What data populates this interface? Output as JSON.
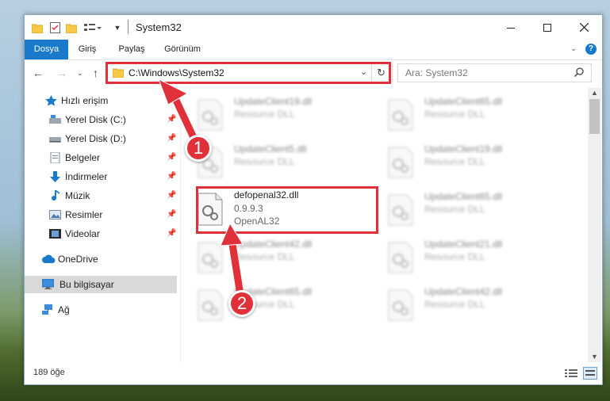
{
  "window": {
    "title": "System32"
  },
  "ribbon": {
    "tabs": [
      "Dosya",
      "Giriş",
      "Paylaş",
      "Görünüm"
    ]
  },
  "address": {
    "path": "C:\\Windows\\System32"
  },
  "search": {
    "placeholder": "Ara: System32"
  },
  "sidebar": {
    "items": [
      {
        "label": "Hızlı erişim"
      },
      {
        "label": "Yerel Disk (C:)"
      },
      {
        "label": "Yerel Disk (D:)"
      },
      {
        "label": "Belgeler"
      },
      {
        "label": "İndirmeler"
      },
      {
        "label": "Müzik"
      },
      {
        "label": "Resimler"
      },
      {
        "label": "Videolar"
      },
      {
        "label": "OneDrive"
      },
      {
        "label": "Bu bilgisayar"
      },
      {
        "label": "Ağ"
      }
    ]
  },
  "files": {
    "left": [
      {
        "name": "UpdateClient19.dll",
        "desc": "Resource DLL"
      },
      {
        "name": "UpdateClient5.dll",
        "desc": "Resource DLL"
      },
      {
        "name": "defopenal32.dll",
        "version": "0.9.9.3",
        "desc": "OpenAL32"
      },
      {
        "name": "UpdateClient42.dll",
        "desc": "Resource DLL"
      },
      {
        "name": "UpdateClient65.dll",
        "desc": "Resource DLL"
      }
    ],
    "right": [
      {
        "name": "UpdateClient65.dll",
        "desc": "Resource DLL"
      },
      {
        "name": "UpdateClient19.dll",
        "desc": "Resource DLL"
      },
      {
        "name": "UpdateClient65.dll",
        "desc": "Resource DLL"
      },
      {
        "name": "UpdateClient21.dll",
        "desc": "Resource DLL"
      },
      {
        "name": "UpdateClient42.dll",
        "desc": "Resource DLL"
      }
    ]
  },
  "status": {
    "count": "189 öğe"
  },
  "callouts": {
    "one": "1",
    "two": "2"
  },
  "colors": {
    "accent": "#1979ca",
    "highlight": "#e0313a"
  }
}
